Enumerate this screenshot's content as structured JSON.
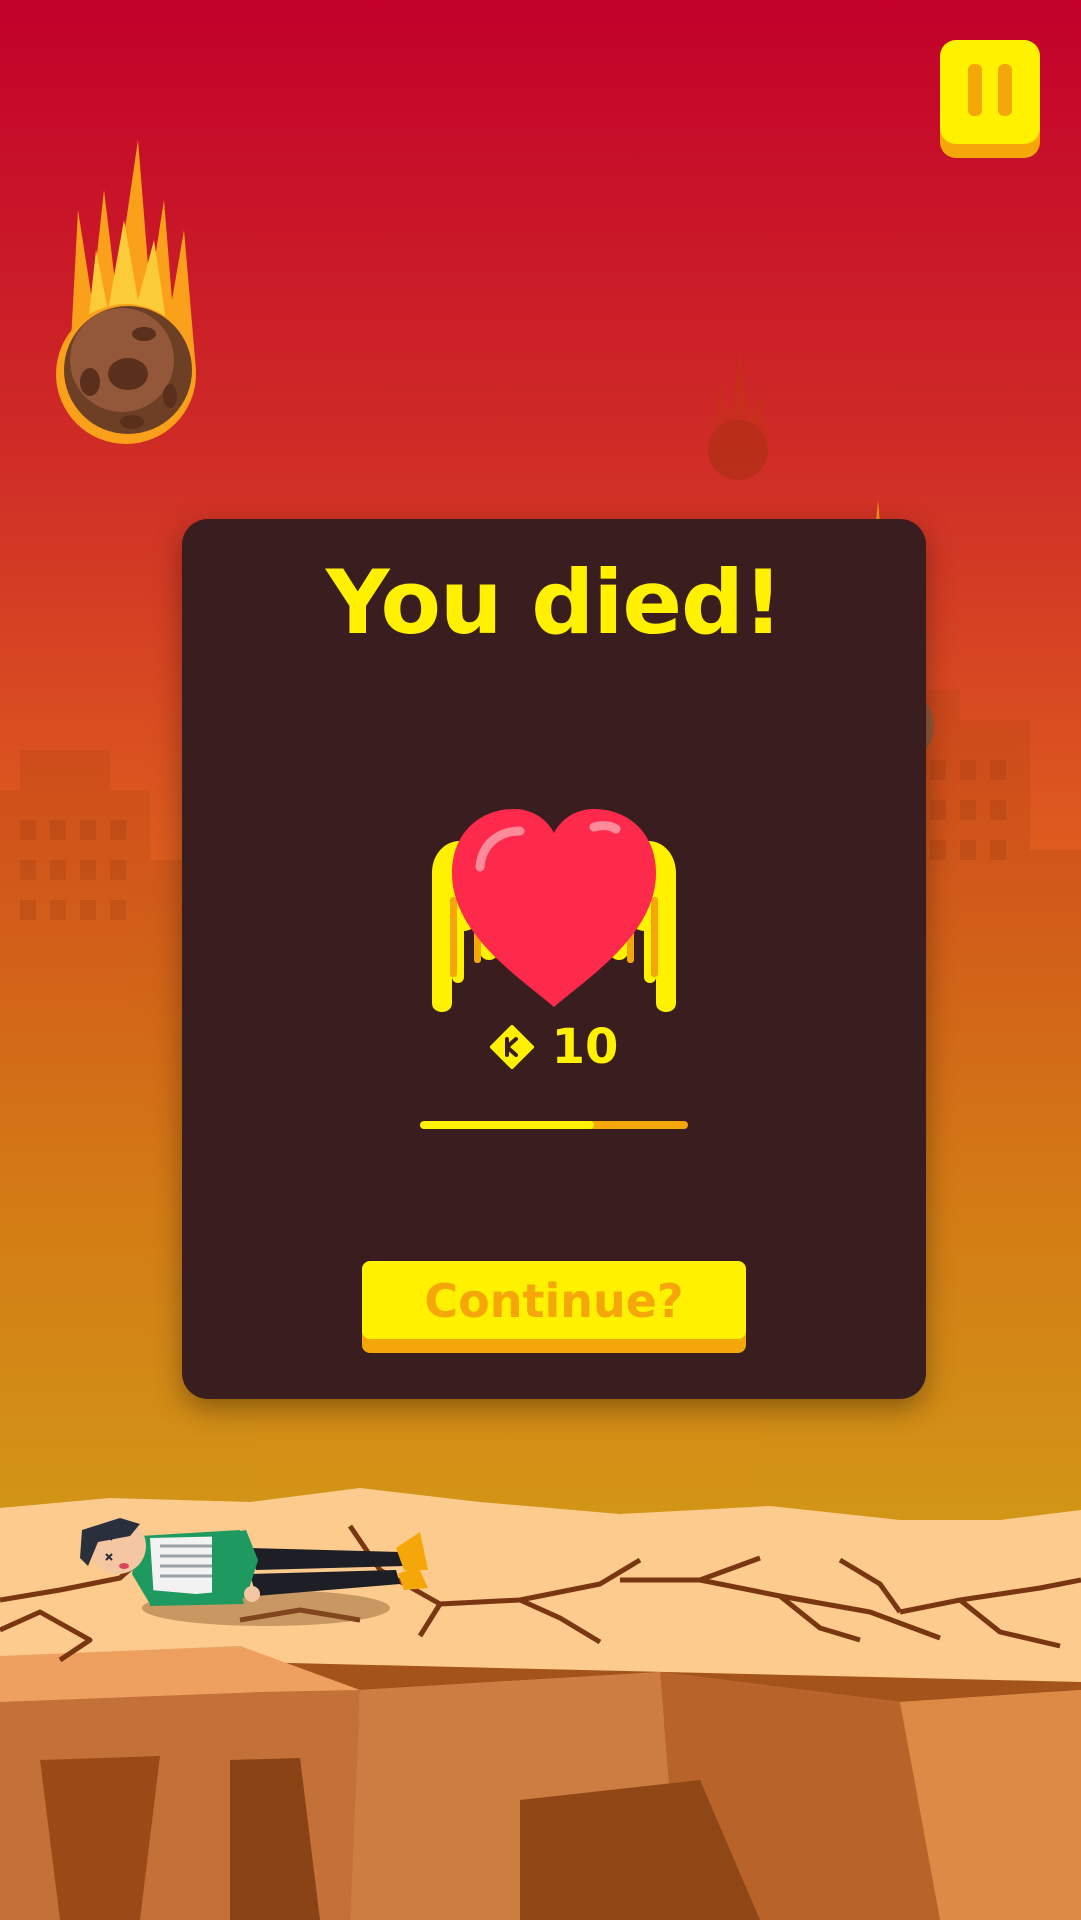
{
  "dialog": {
    "title": "You died!",
    "continue_label": "Continue?"
  },
  "reward": {
    "coin_count": "10",
    "progress": 0.65
  },
  "icons": {
    "pause": "pause-icon",
    "life": "winged-heart-icon",
    "coin": "coin-icon"
  },
  "colors": {
    "accent_yellow": "#fff100",
    "accent_orange": "#f5a70a",
    "panel_bg": "#3a1e1f",
    "heart_red": "#fe2a4b",
    "sky_top": "#c2002a",
    "sky_bottom": "#e0b018",
    "ground": "#fccb8d"
  }
}
